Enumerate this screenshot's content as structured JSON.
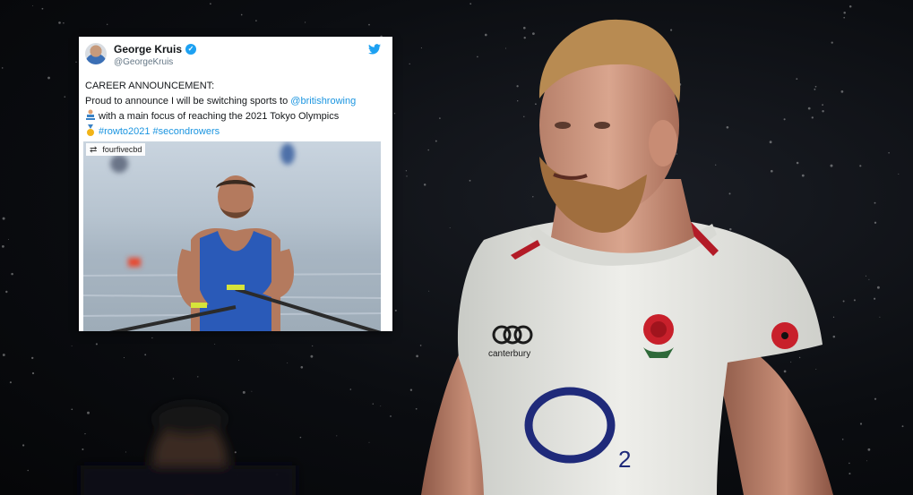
{
  "tweet": {
    "name": "George Kruis",
    "handle": "@GeorgeKruis",
    "line1": "CAREER ANNOUNCEMENT:",
    "line2_text": "Proud to announce I will be switching sports to ",
    "line2_link": "@britishrowing",
    "line3_text": "with a main focus of reaching the 2021 Tokyo Olympics",
    "hashtags": "#rowto2021 #secondrowers",
    "repost_user": "fourfivecbd"
  },
  "jersey": {
    "brand": "canterbury",
    "sponsor": "O",
    "sponsor_sub": "2"
  },
  "colors": {
    "twitter_blue": "#1da1f2",
    "link_blue": "#1b95e0",
    "jersey_white": "#e8e9e6",
    "sponsor_navy": "#1f2a7a",
    "rose_red": "#c8202b"
  }
}
